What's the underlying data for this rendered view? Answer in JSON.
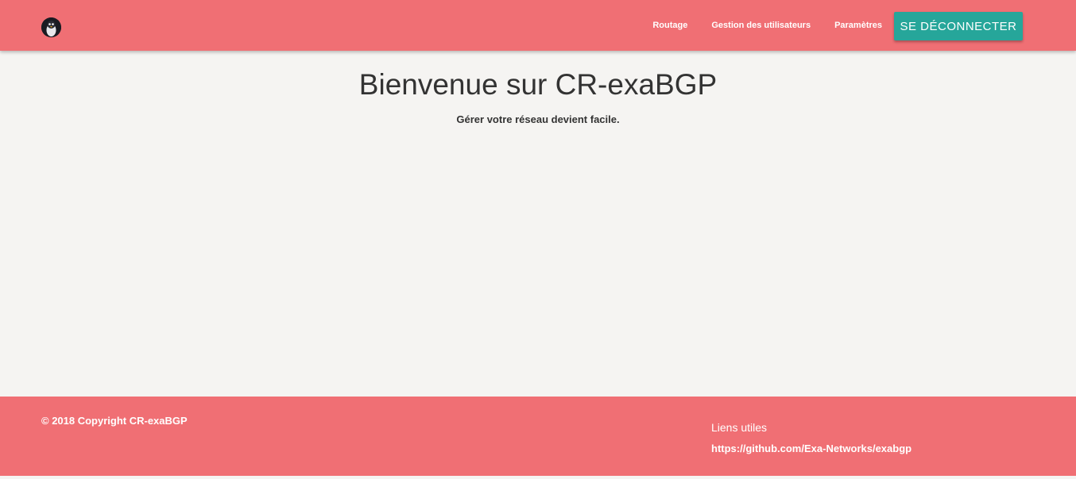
{
  "colors": {
    "navbar_bg": "#f06f74",
    "logout_bg": "#26a69a",
    "page_bg": "#f5f4f2",
    "footer_bg": "#f06f74"
  },
  "navbar": {
    "logo_icon": "penguin-logo-icon",
    "links": [
      {
        "label": "Routage"
      },
      {
        "label": "Gestion des utilisateurs"
      },
      {
        "label": "Paramètres"
      }
    ],
    "logout_label": "SE DÉCONNECTER"
  },
  "hero": {
    "title": "Bienvenue sur CR-exaBGP",
    "subtitle": "Gérer votre réseau devient facile."
  },
  "footer": {
    "copyright": "© 2018 Copyright CR-exaBGP",
    "links_title": "Liens utiles",
    "links": [
      {
        "label": "https://github.com/Exa-Networks/exabgp"
      }
    ]
  }
}
